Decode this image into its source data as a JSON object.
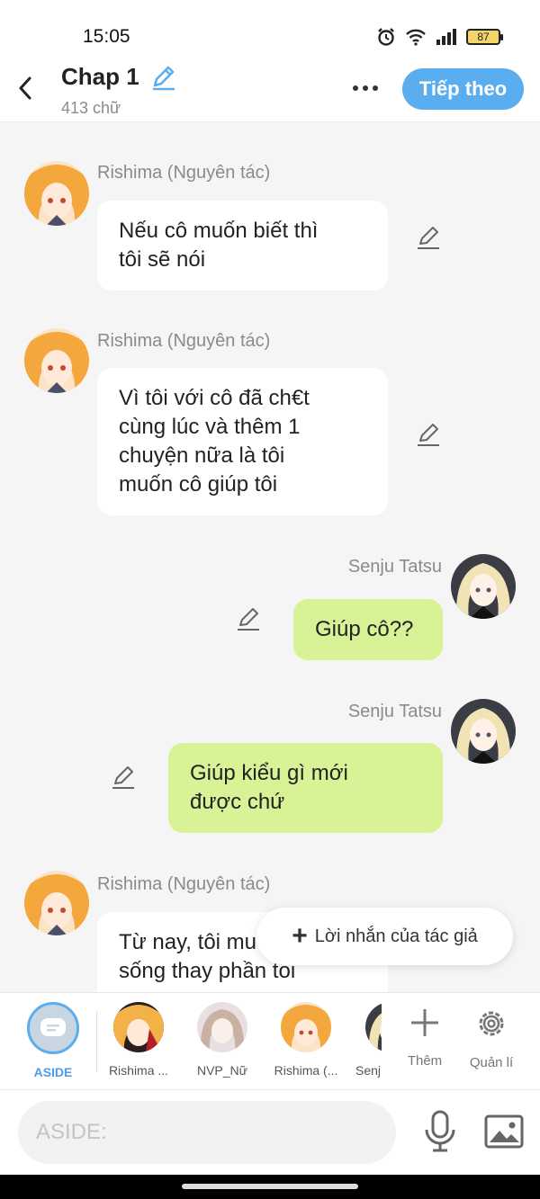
{
  "status_bar": {
    "time": "15:05",
    "battery": "87"
  },
  "header": {
    "title": "Chap 1",
    "word_count": "413 chữ",
    "next_label": "Tiếp theo"
  },
  "messages": [
    {
      "sender": "Rishima (Nguyên tác)",
      "side": "left",
      "lines": [
        "Nếu cô muốn biết thì",
        "tôi sẽ nói"
      ]
    },
    {
      "sender": "Rishima (Nguyên tác)",
      "side": "left",
      "lines": [
        "Vì tôi với cô đã ch€t",
        "cùng lúc và thêm 1",
        "chuyện nữa là tôi",
        "muốn cô giúp tôi"
      ]
    },
    {
      "sender": "Senju Tatsu",
      "side": "right",
      "lines": [
        "Giúp cô??"
      ]
    },
    {
      "sender": "Senju Tatsu",
      "side": "right",
      "lines": [
        "Giúp kiểu gì mới",
        "được chứ"
      ]
    },
    {
      "sender": "Rishima (Nguyên tác)",
      "side": "left",
      "lines": [
        "Từ nay, tôi mu",
        "sống thay phần tôi"
      ]
    }
  ],
  "author_note": {
    "label": "Lời nhắn của tác giả"
  },
  "characters": [
    {
      "label": "ASIDE"
    },
    {
      "label": "Rishima ..."
    },
    {
      "label": "NVP_Nữ"
    },
    {
      "label": "Rishima (..."
    },
    {
      "label": "Senj"
    }
  ],
  "tools": {
    "add_label": "Thêm",
    "manage_label": "Quản lí"
  },
  "input": {
    "placeholder": "ASIDE:"
  },
  "colors": {
    "accent": "#5aaeef",
    "bubble_right": "#d8f396",
    "bubble_left": "#ffffff",
    "background": "#f5f5f5"
  }
}
